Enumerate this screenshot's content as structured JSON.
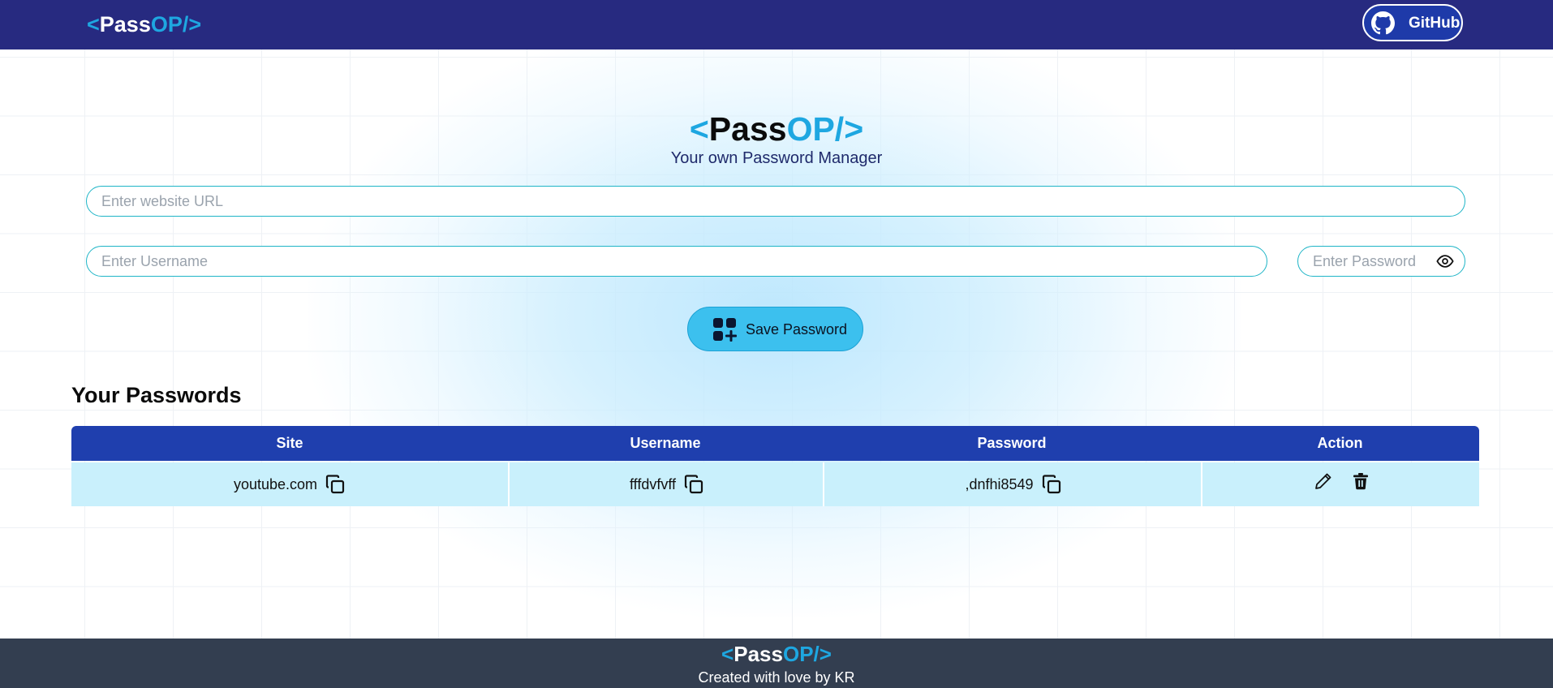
{
  "brand": {
    "lt": "<",
    "pass": "Pass",
    "op": "OP/",
    "gt": ">"
  },
  "navbar": {
    "github_label": "GitHub"
  },
  "hero": {
    "subtitle": "Your own Password Manager"
  },
  "form": {
    "url_placeholder": "Enter website URL",
    "username_placeholder": "Enter Username",
    "password_placeholder": "Enter Password",
    "save_label": "Save Password"
  },
  "passwords": {
    "title": "Your Passwords",
    "columns": [
      "Site",
      "Username",
      "Password",
      "Action"
    ],
    "rows": [
      {
        "site": "youtube.com",
        "username": "fffdvfvff",
        "password": ",dnfhi8549"
      }
    ]
  },
  "footer": {
    "text": "Created with love by KR"
  },
  "colors": {
    "navbar": "#272a80",
    "accent": "#1ea7e1",
    "table_header": "#1f3fae",
    "table_row": "#c9f0fc",
    "save_button": "#3cc0ee",
    "footer": "#333e50"
  },
  "icons": [
    "github-icon",
    "eye-icon",
    "add-icon",
    "copy-icon",
    "edit-icon",
    "trash-icon"
  ]
}
